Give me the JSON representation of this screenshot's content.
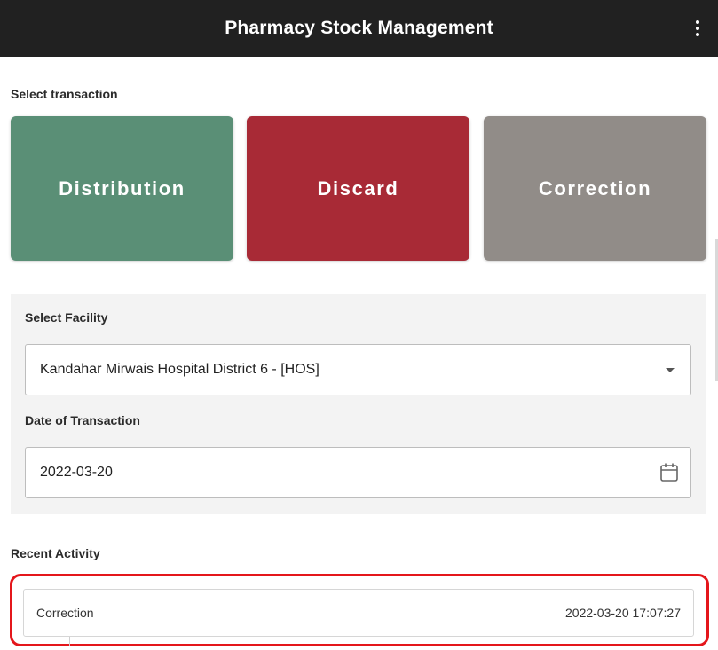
{
  "appbar": {
    "title": "Pharmacy Stock Management",
    "menu_icon": "more-vertical-icon"
  },
  "select_transaction": {
    "label": "Select transaction",
    "options": [
      {
        "label": "Distribution",
        "color": "#5a8f76"
      },
      {
        "label": "Discard",
        "color": "#a82a36"
      },
      {
        "label": "Correction",
        "color": "#918c88"
      }
    ]
  },
  "form": {
    "facility_label": "Select Facility",
    "facility_value": "Kandahar Mirwais Hospital District 6 -  [HOS]",
    "date_label": "Date of Transaction",
    "date_value": "2022-03-20"
  },
  "recent_activity": {
    "label": "Recent Activity",
    "items": [
      {
        "type": "Correction",
        "timestamp": "2022-03-20 17:07:27"
      }
    ]
  },
  "colors": {
    "appbar_bg": "#212121",
    "highlight": "#e4161b",
    "panel_bg": "#f3f3f3"
  }
}
